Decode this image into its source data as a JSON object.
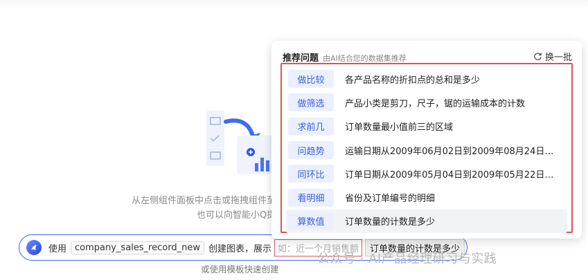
{
  "empty_state": {
    "hint_line1": "从左侧组件面板中点击或拖拽组件至",
    "hint_line2": "也可以向智能小Q提"
  },
  "input_bar": {
    "prefix": "使用",
    "dataset": "company_sales_record_new",
    "middle": "创建图表，展示",
    "placeholder": "如：近一个月销售额",
    "selected_question": "订单数量的计数是多少"
  },
  "template_link": "或使用模板快速创建",
  "watermark": "公众号 · AI产品经理研习与实践",
  "popover": {
    "title": "推荐问题",
    "subtitle": "由AI结合您的数据集推荐",
    "refresh_label": "换一批",
    "items": [
      {
        "tag": "做比较",
        "text": "各产品名称的折扣点的总和是多少"
      },
      {
        "tag": "做筛选",
        "text": "产品小类是剪刀，尺子，锯的运输成本的计数"
      },
      {
        "tag": "求前几",
        "text": "订单数量最小值前三的区域"
      },
      {
        "tag": "问趋势",
        "text": "运输日期从2009年06月02日到2009年08月24日的..."
      },
      {
        "tag": "同环比",
        "text": "订单日期从2009年05月04日到2009年05月22日的..."
      },
      {
        "tag": "看明细",
        "text": "省份及订单编号的明细"
      },
      {
        "tag": "算数值",
        "text": "订单数量的计数是多少"
      }
    ]
  },
  "colors": {
    "accent": "#3f63f3",
    "tag_bg": "#eaf0ff",
    "tag_text": "#3a5fe5",
    "highlight_border": "#e05050"
  }
}
